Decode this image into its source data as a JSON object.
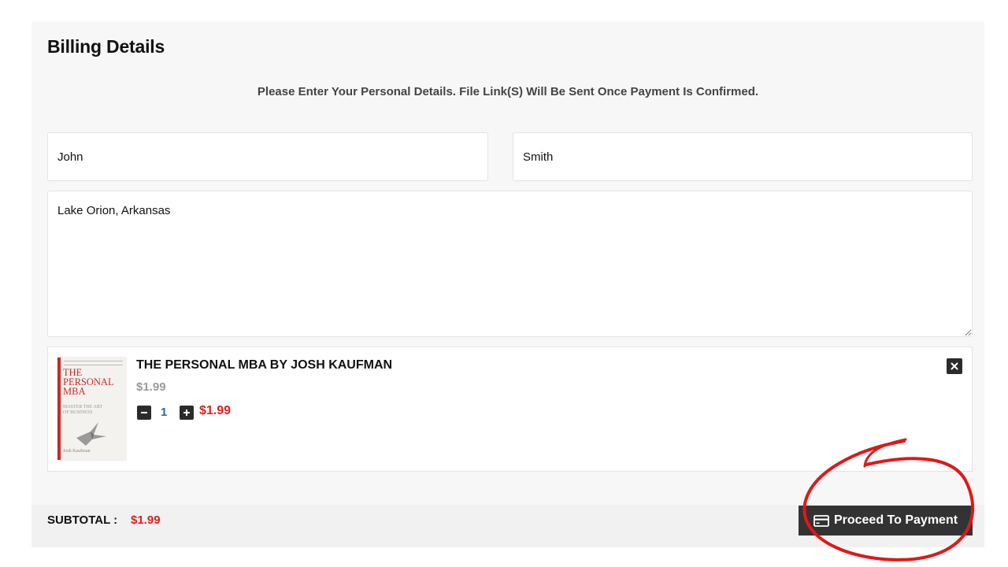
{
  "page": {
    "title": "Billing Details",
    "subtitle": "Please Enter Your Personal Details. File Link(S) Will Be Sent Once Payment Is Confirmed."
  },
  "form": {
    "first_name": "John",
    "last_name": "Smith",
    "address": "Lake Orion, Arkansas"
  },
  "cart": {
    "items": [
      {
        "name": "THE PERSONAL MBA BY JOSH KAUFMAN",
        "unit_price": "$1.99",
        "quantity": "1",
        "line_total": "$1.99",
        "cover": {
          "title": "THE PERSONAL MBA",
          "subtitle": "MASTER THE ART OF BUSINESS",
          "author": "Josh Kaufman",
          "accent_color": "#c42a2a"
        }
      }
    ]
  },
  "footer": {
    "subtotal_label": "SUBTOTAL :",
    "subtotal_value": "$1.99",
    "pay_button_label": "Proceed To Payment",
    "pay_button_icon": "credit-card-icon"
  },
  "colors": {
    "price_red": "#e02020",
    "quantity_blue": "#2a6aa0",
    "button_dark": "#333333",
    "annotation_red": "#e01818"
  }
}
